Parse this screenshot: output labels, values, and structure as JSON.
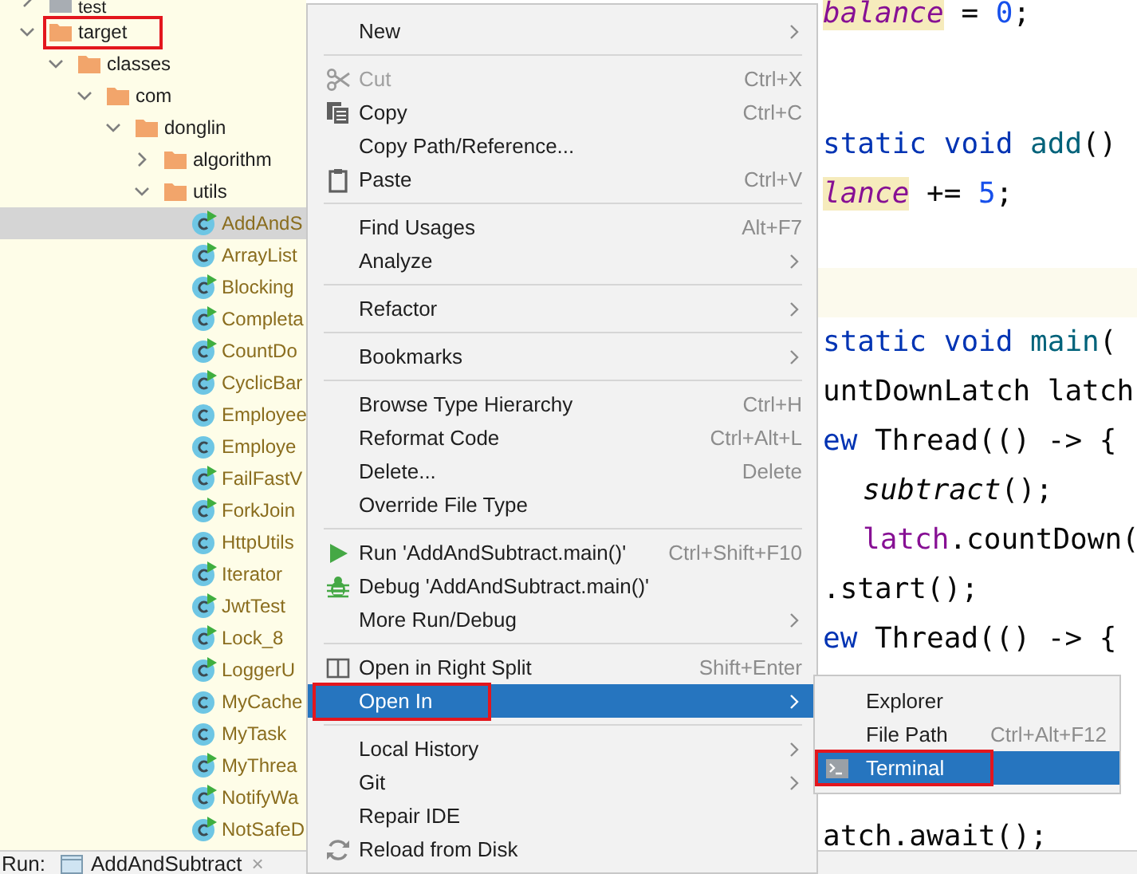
{
  "project_tree": [
    {
      "label": "test",
      "kind": "excluded-folder",
      "expanded": false,
      "selected": false,
      "annotated": false
    },
    {
      "label": "target",
      "kind": "folder",
      "expanded": true,
      "selected": false,
      "annotated": true,
      "children": [
        {
          "label": "classes",
          "kind": "folder",
          "expanded": true,
          "selected": false,
          "annotated": false,
          "children": [
            {
              "label": "com",
              "kind": "folder",
              "expanded": true,
              "selected": false,
              "annotated": false,
              "children": [
                {
                  "label": "donglin",
                  "kind": "folder",
                  "expanded": true,
                  "selected": false,
                  "annotated": false,
                  "children": [
                    {
                      "label": "algorithm",
                      "kind": "folder",
                      "expanded": false,
                      "selected": false,
                      "annotated": false
                    },
                    {
                      "label": "utils",
                      "kind": "folder",
                      "expanded": true,
                      "selected": false,
                      "annotated": false,
                      "children": [
                        {
                          "label": "AddAndS",
                          "kind": "class",
                          "runnable": true,
                          "selected": true,
                          "annotated": false
                        },
                        {
                          "label": "ArrayList",
                          "kind": "class",
                          "runnable": true,
                          "selected": false,
                          "annotated": false
                        },
                        {
                          "label": "Blocking",
                          "kind": "class",
                          "runnable": true,
                          "selected": false,
                          "annotated": false
                        },
                        {
                          "label": "Completa",
                          "kind": "class",
                          "runnable": true,
                          "selected": false,
                          "annotated": false
                        },
                        {
                          "label": "CountDo",
                          "kind": "class",
                          "runnable": true,
                          "selected": false,
                          "annotated": false
                        },
                        {
                          "label": "CyclicBar",
                          "kind": "class",
                          "runnable": true,
                          "selected": false,
                          "annotated": false
                        },
                        {
                          "label": "Employee",
                          "kind": "class",
                          "runnable": false,
                          "selected": false,
                          "annotated": false
                        },
                        {
                          "label": "Employe",
                          "kind": "class",
                          "runnable": false,
                          "selected": false,
                          "annotated": false
                        },
                        {
                          "label": "FailFastV",
                          "kind": "class",
                          "runnable": true,
                          "selected": false,
                          "annotated": false
                        },
                        {
                          "label": "ForkJoin",
                          "kind": "class",
                          "runnable": true,
                          "selected": false,
                          "annotated": false
                        },
                        {
                          "label": "HttpUtils",
                          "kind": "class",
                          "runnable": false,
                          "selected": false,
                          "annotated": false
                        },
                        {
                          "label": "Iterator",
                          "kind": "class",
                          "runnable": true,
                          "selected": false,
                          "annotated": false
                        },
                        {
                          "label": "JwtTest",
                          "kind": "class",
                          "runnable": true,
                          "selected": false,
                          "annotated": false
                        },
                        {
                          "label": "Lock_8",
                          "kind": "class",
                          "runnable": true,
                          "selected": false,
                          "annotated": false
                        },
                        {
                          "label": "LoggerU",
                          "kind": "class",
                          "runnable": true,
                          "selected": false,
                          "annotated": false
                        },
                        {
                          "label": "MyCache",
                          "kind": "class",
                          "runnable": false,
                          "selected": false,
                          "annotated": false
                        },
                        {
                          "label": "MyTask",
                          "kind": "class",
                          "runnable": false,
                          "selected": false,
                          "annotated": false
                        },
                        {
                          "label": "MyThrea",
                          "kind": "class",
                          "runnable": true,
                          "selected": false,
                          "annotated": false
                        },
                        {
                          "label": "NotifyWa",
                          "kind": "class",
                          "runnable": true,
                          "selected": false,
                          "annotated": false
                        },
                        {
                          "label": "NotSafeD",
                          "kind": "class",
                          "runnable": true,
                          "selected": false,
                          "annotated": false
                        }
                      ]
                    }
                  ]
                }
              ]
            }
          ]
        }
      ]
    }
  ],
  "editor": {
    "lines": [
      {
        "kind": "code",
        "tokens": [
          {
            "kind": "static-field",
            "text": "balance"
          },
          {
            "kind": "plain",
            "text": " = "
          },
          {
            "kind": "number",
            "text": "0"
          },
          {
            "kind": "plain",
            "text": ";"
          }
        ]
      },
      {
        "kind": "blank"
      },
      {
        "kind": "blank"
      },
      {
        "kind": "code",
        "tokens": [
          {
            "kind": "keyword",
            "text": "static void "
          },
          {
            "kind": "method",
            "text": "add"
          },
          {
            "kind": "plain",
            "text": "()"
          }
        ]
      },
      {
        "kind": "code",
        "tokens": [
          {
            "kind": "static-field",
            "text": "lance"
          },
          {
            "kind": "plain",
            "text": " += "
          },
          {
            "kind": "number",
            "text": "5"
          },
          {
            "kind": "plain",
            "text": ";"
          }
        ]
      },
      {
        "kind": "blank"
      },
      {
        "kind": "caret-line"
      },
      {
        "kind": "code",
        "tokens": [
          {
            "kind": "keyword",
            "text": "static void "
          },
          {
            "kind": "method",
            "text": "main"
          },
          {
            "kind": "plain",
            "text": "("
          }
        ]
      },
      {
        "kind": "code",
        "tokens": [
          {
            "kind": "plain",
            "text": "untDownLatch latch"
          }
        ]
      },
      {
        "kind": "code",
        "tokens": [
          {
            "kind": "keyword",
            "text": "ew"
          },
          {
            "kind": "plain",
            "text": " Thread(() -> {"
          }
        ]
      },
      {
        "kind": "indented-code",
        "tokens": [
          {
            "kind": "static-call",
            "text": "subtract"
          },
          {
            "kind": "plain",
            "text": "();"
          }
        ]
      },
      {
        "kind": "indented-code",
        "tokens": [
          {
            "kind": "local",
            "text": "latch"
          },
          {
            "kind": "plain",
            "text": ".countDown("
          }
        ]
      },
      {
        "kind": "code",
        "tokens": [
          {
            "kind": "plain",
            "text": ".start();"
          }
        ]
      },
      {
        "kind": "code",
        "tokens": [
          {
            "kind": "keyword",
            "text": "ew"
          },
          {
            "kind": "plain",
            "text": " Thread(() -> {"
          }
        ]
      },
      {
        "kind": "blank"
      },
      {
        "kind": "blank"
      },
      {
        "kind": "blank"
      },
      {
        "kind": "code",
        "tokens": [
          {
            "kind": "plain",
            "text": "atch.await();"
          }
        ]
      }
    ]
  },
  "context_menu": {
    "items": [
      {
        "kind": "item",
        "label": "New",
        "submenu": true,
        "disabled": false,
        "selected": false,
        "annotated": false
      },
      {
        "kind": "separator"
      },
      {
        "kind": "item",
        "label": "Cut",
        "shortcut": "Ctrl+X",
        "submenu": false,
        "disabled": true,
        "selected": false,
        "annotated": false
      },
      {
        "kind": "item",
        "label": "Copy",
        "shortcut": "Ctrl+C",
        "submenu": false,
        "disabled": false,
        "selected": false,
        "annotated": false
      },
      {
        "kind": "item",
        "label": "Copy Path/Reference...",
        "submenu": false,
        "disabled": false,
        "selected": false,
        "annotated": false
      },
      {
        "kind": "item",
        "label": "Paste",
        "shortcut": "Ctrl+V",
        "submenu": false,
        "disabled": false,
        "selected": false,
        "annotated": false
      },
      {
        "kind": "separator"
      },
      {
        "kind": "item",
        "label": "Find Usages",
        "shortcut": "Alt+F7",
        "submenu": false,
        "disabled": false,
        "selected": false,
        "annotated": false
      },
      {
        "kind": "item",
        "label": "Analyze",
        "submenu": true,
        "disabled": false,
        "selected": false,
        "annotated": false
      },
      {
        "kind": "separator"
      },
      {
        "kind": "item",
        "label": "Refactor",
        "submenu": true,
        "disabled": false,
        "selected": false,
        "annotated": false
      },
      {
        "kind": "separator"
      },
      {
        "kind": "item",
        "label": "Bookmarks",
        "submenu": true,
        "disabled": false,
        "selected": false,
        "annotated": false
      },
      {
        "kind": "separator"
      },
      {
        "kind": "item",
        "label": "Browse Type Hierarchy",
        "shortcut": "Ctrl+H",
        "submenu": false,
        "disabled": false,
        "selected": false,
        "annotated": false
      },
      {
        "kind": "item",
        "label": "Reformat Code",
        "shortcut": "Ctrl+Alt+L",
        "submenu": false,
        "disabled": false,
        "selected": false,
        "annotated": false
      },
      {
        "kind": "item",
        "label": "Delete...",
        "shortcut": "Delete",
        "submenu": false,
        "disabled": false,
        "selected": false,
        "annotated": false
      },
      {
        "kind": "item",
        "label": "Override File Type",
        "submenu": false,
        "disabled": false,
        "selected": false,
        "annotated": false
      },
      {
        "kind": "separator"
      },
      {
        "kind": "item",
        "label": "Run 'AddAndSubtract.main()'",
        "shortcut": "Ctrl+Shift+F10",
        "submenu": false,
        "disabled": false,
        "selected": false,
        "annotated": false
      },
      {
        "kind": "item",
        "label": "Debug 'AddAndSubtract.main()'",
        "submenu": false,
        "disabled": false,
        "selected": false,
        "annotated": false
      },
      {
        "kind": "item",
        "label": "More Run/Debug",
        "submenu": true,
        "disabled": false,
        "selected": false,
        "annotated": false
      },
      {
        "kind": "separator"
      },
      {
        "kind": "item",
        "label": "Open in Right Split",
        "shortcut": "Shift+Enter",
        "submenu": false,
        "disabled": false,
        "selected": false,
        "annotated": false
      },
      {
        "kind": "item",
        "label": "Open In",
        "submenu": true,
        "disabled": false,
        "selected": true,
        "annotated": true
      },
      {
        "kind": "separator"
      },
      {
        "kind": "item",
        "label": "Local History",
        "submenu": true,
        "disabled": false,
        "selected": false,
        "annotated": false
      },
      {
        "kind": "item",
        "label": "Git",
        "submenu": true,
        "disabled": false,
        "selected": false,
        "annotated": false
      },
      {
        "kind": "item",
        "label": "Repair IDE",
        "submenu": false,
        "disabled": false,
        "selected": false,
        "annotated": false
      },
      {
        "kind": "item",
        "label": "Reload from Disk",
        "submenu": false,
        "disabled": false,
        "selected": false,
        "annotated": false
      }
    ]
  },
  "submenu": {
    "items": [
      {
        "label": "Explorer",
        "selected": false,
        "annotated": false
      },
      {
        "label": "File Path",
        "shortcut": "Ctrl+Alt+F12",
        "selected": false,
        "annotated": false
      },
      {
        "label": "Terminal",
        "selected": true,
        "annotated": true
      }
    ]
  },
  "run_bar": {
    "label": "Run:",
    "tab": "AddAndSubtract",
    "close": "×"
  }
}
